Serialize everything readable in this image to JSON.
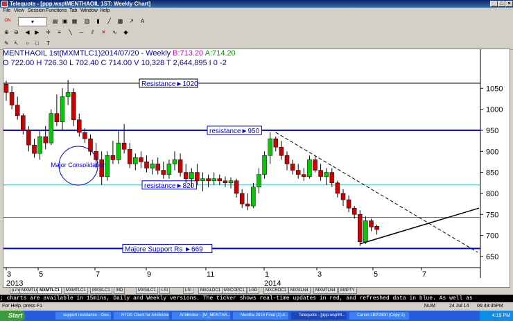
{
  "window": {
    "title": "Telequote - [ppp.wsp\\MENTHAOIL 1ST: Weekly Chart]"
  },
  "menu": [
    "File",
    "View",
    "Session",
    "Functions",
    "Tab",
    "Window",
    "Help"
  ],
  "chart_header": {
    "line1_prefix": "MENTHAOIL 1st(MXMTLC1)2014/07/20   - Weekly ",
    "bid": "B:713.20",
    "ask": "A:714.20",
    "line2": "O 722.00 H 726.30 L 702.40 C 714.00 V 10,328 T 2,644,895 I 0  -2"
  },
  "chart_data": {
    "type": "candlestick",
    "ylim": [
      640,
      1090
    ],
    "y_ticks": [
      650,
      700,
      750,
      800,
      850,
      900,
      950,
      1000,
      1050
    ],
    "x_ticks": [
      "3",
      "5",
      "7",
      "9",
      "11",
      "1",
      "3",
      "5",
      "7"
    ],
    "year_labels": [
      "2013",
      "2014"
    ],
    "levels": [
      {
        "label": "Resistance►1020",
        "value": 1062,
        "color": "#000000"
      },
      {
        "label": "resistance►950",
        "value": 950,
        "color": "#0000cc"
      },
      {
        "label": "resistance►820",
        "value": 820,
        "color": "#2bbfbf"
      },
      {
        "label": "",
        "value": 743,
        "color": "#20a020"
      },
      {
        "label": "Majore Support  Rs ►669",
        "value": 669,
        "color": "#0000cc"
      }
    ],
    "annotation": "Major Consolidation",
    "candles": [
      [
        1060,
        1068,
        1020,
        1040
      ],
      [
        1040,
        1055,
        1000,
        1010
      ],
      [
        1010,
        1030,
        975,
        985
      ],
      [
        985,
        990,
        940,
        950
      ],
      [
        950,
        960,
        900,
        915
      ],
      [
        915,
        930,
        885,
        895
      ],
      [
        895,
        950,
        880,
        935
      ],
      [
        935,
        960,
        905,
        920
      ],
      [
        920,
        1000,
        915,
        990
      ],
      [
        990,
        1035,
        960,
        970
      ],
      [
        970,
        1050,
        950,
        1030
      ],
      [
        1030,
        1070,
        1010,
        1040
      ],
      [
        1040,
        1050,
        960,
        975
      ],
      [
        975,
        990,
        935,
        945
      ],
      [
        945,
        955,
        920,
        930
      ],
      [
        930,
        940,
        890,
        900
      ],
      [
        900,
        920,
        860,
        880
      ],
      [
        880,
        900,
        820,
        840
      ],
      [
        840,
        900,
        830,
        890
      ],
      [
        890,
        925,
        870,
        880
      ],
      [
        880,
        950,
        870,
        920
      ],
      [
        920,
        965,
        895,
        905
      ],
      [
        905,
        920,
        860,
        870
      ],
      [
        870,
        895,
        855,
        885
      ],
      [
        885,
        900,
        860,
        875
      ],
      [
        875,
        890,
        850,
        860
      ],
      [
        860,
        880,
        845,
        870
      ],
      [
        870,
        885,
        845,
        855
      ],
      [
        855,
        875,
        835,
        845
      ],
      [
        845,
        880,
        835,
        870
      ],
      [
        870,
        900,
        855,
        880
      ],
      [
        880,
        895,
        840,
        850
      ],
      [
        850,
        870,
        825,
        835
      ],
      [
        835,
        860,
        815,
        850
      ],
      [
        850,
        870,
        820,
        830
      ],
      [
        830,
        850,
        805,
        835
      ],
      [
        835,
        845,
        815,
        830
      ],
      [
        830,
        850,
        820,
        835
      ],
      [
        835,
        845,
        820,
        830
      ],
      [
        830,
        840,
        815,
        825
      ],
      [
        825,
        838,
        812,
        830
      ],
      [
        830,
        835,
        790,
        800
      ],
      [
        800,
        810,
        765,
        775
      ],
      [
        775,
        800,
        760,
        770
      ],
      [
        770,
        825,
        765,
        815
      ],
      [
        815,
        860,
        800,
        845
      ],
      [
        845,
        900,
        835,
        890
      ],
      [
        890,
        945,
        870,
        930
      ],
      [
        930,
        935,
        900,
        910
      ],
      [
        910,
        925,
        880,
        890
      ],
      [
        890,
        900,
        855,
        870
      ],
      [
        870,
        880,
        845,
        855
      ],
      [
        855,
        870,
        835,
        845
      ],
      [
        845,
        860,
        830,
        840
      ],
      [
        840,
        890,
        835,
        880
      ],
      [
        880,
        888,
        850,
        855
      ],
      [
        855,
        870,
        830,
        840
      ],
      [
        840,
        860,
        820,
        850
      ],
      [
        850,
        860,
        815,
        825
      ],
      [
        825,
        830,
        790,
        800
      ],
      [
        800,
        810,
        770,
        785
      ],
      [
        785,
        795,
        755,
        765
      ],
      [
        765,
        770,
        740,
        750
      ],
      [
        750,
        760,
        675,
        685
      ],
      [
        685,
        745,
        680,
        735
      ],
      [
        735,
        740,
        710,
        720
      ],
      [
        722,
        726,
        702,
        714
      ]
    ]
  },
  "tabs": [
    "p.mon",
    "MXMTLC1",
    "MXMTLC1",
    "MXMTLC1",
    "MXSILC1",
    "IND",
    "MXSILC1",
    "LSI",
    "LSI",
    "MXGLDC1",
    "MXCOPC1",
    "LGD",
    "MXCROC1",
    "MXSILN4",
    "MXMTLN4",
    "EMPTY"
  ],
  "ticker": "; charts are available in 15mins, Daily and Weekly versions. The ticker shows real-time updates in red, and refreshed data in blue. As well as",
  "status": {
    "left": "For Help, press F1",
    "num": "NUM",
    "date": "24 Jul 14",
    "time": "06:49:35PM"
  },
  "taskbar": {
    "start": "Start",
    "items": [
      "support resistance - Goo...",
      "RTDS Client for Amibroker",
      "AmiBroker - [M_MENTHA...",
      "Mentha 2014 Final (2).d...",
      "Telequote - [ppp.wsp\\M...",
      "Canon LBP2900 (Copy 1)"
    ],
    "clock": "4:19 PM"
  }
}
